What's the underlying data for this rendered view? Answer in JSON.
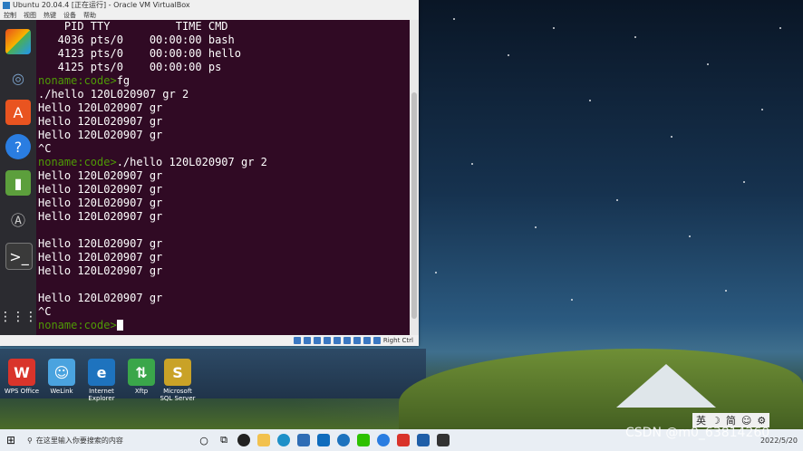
{
  "window": {
    "title": "Ubuntu 20.04.4 [正在运行] - Oracle VM VirtualBox",
    "menu": [
      "控制",
      "视图",
      "热键",
      "设备",
      "帮助"
    ]
  },
  "terminal": {
    "lines": [
      {
        "text": "    PID TTY          TIME CMD",
        "prompt": false
      },
      {
        "text": "   4036 pts/0    00:00:00 bash",
        "prompt": false
      },
      {
        "text": "   4123 pts/0    00:00:00 hello",
        "prompt": false
      },
      {
        "text": "   4125 pts/0    00:00:00 ps",
        "prompt": false
      },
      {
        "prompt_text": "noname:code>",
        "text": "fg",
        "prompt": true
      },
      {
        "text": "./hello 120L020907 gr 2",
        "prompt": false
      },
      {
        "text": "Hello 120L020907 gr",
        "prompt": false
      },
      {
        "text": "Hello 120L020907 gr",
        "prompt": false
      },
      {
        "text": "Hello 120L020907 gr",
        "prompt": false
      },
      {
        "text": "^C",
        "prompt": false
      },
      {
        "prompt_text": "noname:code>",
        "text": "./hello 120L020907 gr 2",
        "prompt": true
      },
      {
        "text": "Hello 120L020907 gr",
        "prompt": false
      },
      {
        "text": "Hello 120L020907 gr",
        "prompt": false
      },
      {
        "text": "Hello 120L020907 gr",
        "prompt": false
      },
      {
        "text": "Hello 120L020907 gr",
        "prompt": false
      },
      {
        "text": "",
        "prompt": false
      },
      {
        "text": "Hello 120L020907 gr",
        "prompt": false
      },
      {
        "text": "Hello 120L020907 gr",
        "prompt": false
      },
      {
        "text": "Hello 120L020907 gr",
        "prompt": false
      },
      {
        "text": "",
        "prompt": false
      },
      {
        "text": "Hello 120L020907 gr",
        "prompt": false
      },
      {
        "text": "^C",
        "prompt": false
      },
      {
        "prompt_text": "noname:code>",
        "text": "",
        "prompt": true,
        "cursor": true
      }
    ]
  },
  "vm_status": {
    "host_key": "Right Ctrl"
  },
  "desktop_icons": [
    {
      "label": "WPS Office",
      "color": "#d9342b",
      "glyph": "W"
    },
    {
      "label": "WeLink",
      "color": "#4aa3df",
      "glyph": "☺"
    },
    {
      "label": "Internet Explorer",
      "color": "#1e73be",
      "glyph": "e"
    },
    {
      "label": "Xftp",
      "color": "#3aa64a",
      "glyph": "⇅"
    },
    {
      "label": "Microsoft SQL Server",
      "color": "#c9a227",
      "glyph": "S"
    }
  ],
  "taskbar": {
    "search_placeholder": "在这里输入你要搜索的内容",
    "clock_date": "2022/5/20"
  },
  "ime": [
    "英",
    "☽",
    "简",
    "☺",
    "⚙"
  ],
  "watermark": "CSDN @m0_63814260"
}
